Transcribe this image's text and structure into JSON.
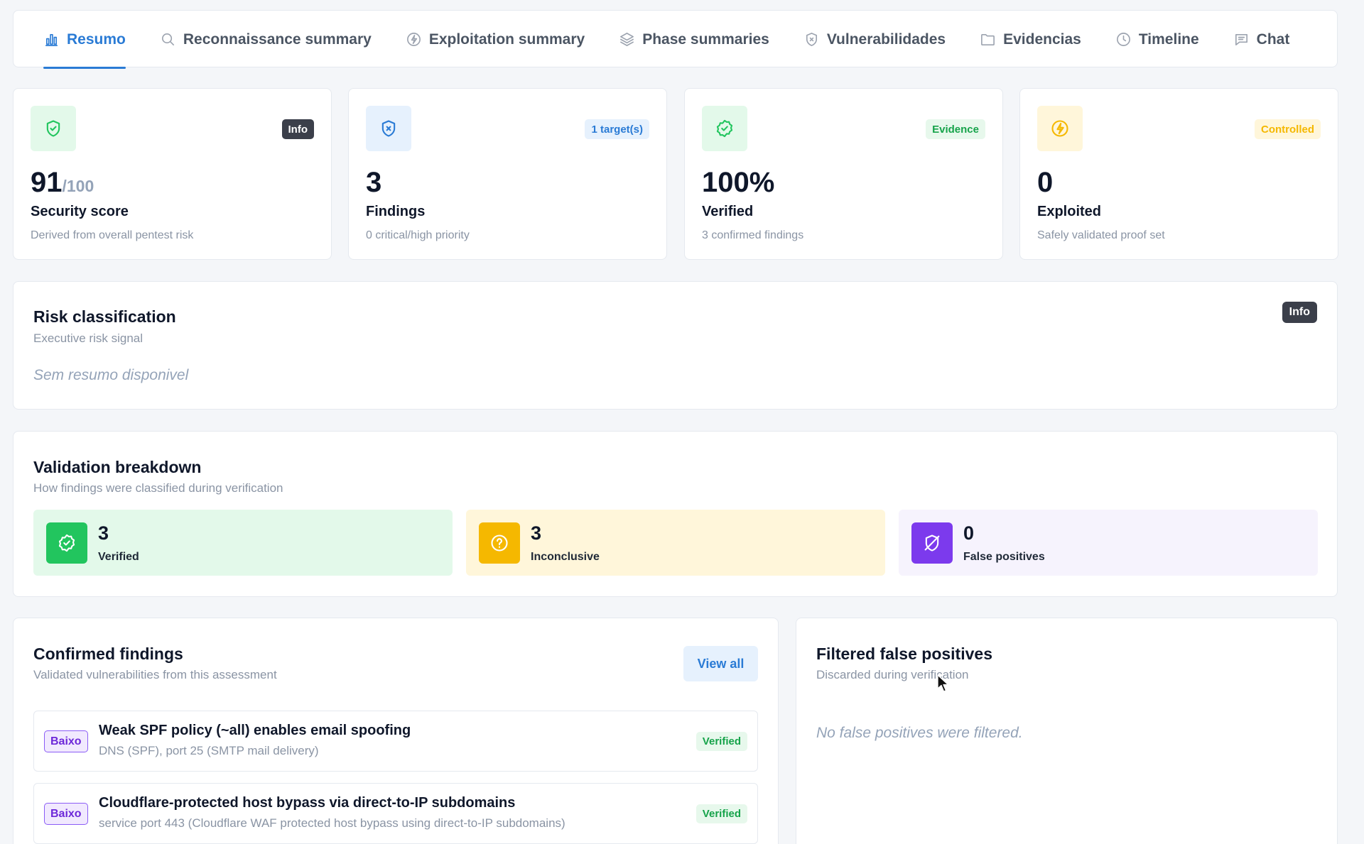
{
  "tabs": [
    {
      "label": "Resumo",
      "icon": "bar-chart-icon",
      "active": true
    },
    {
      "label": "Reconnaissance summary",
      "icon": "search-icon",
      "active": false
    },
    {
      "label": "Exploitation summary",
      "icon": "bolt-circle-icon",
      "active": false
    },
    {
      "label": "Phase summaries",
      "icon": "layers-icon",
      "active": false
    },
    {
      "label": "Vulnerabilidades",
      "icon": "shield-x-icon",
      "active": false
    },
    {
      "label": "Evidencias",
      "icon": "folder-icon",
      "active": false
    },
    {
      "label": "Timeline",
      "icon": "clock-icon",
      "active": false
    },
    {
      "label": "Chat",
      "icon": "chat-icon",
      "active": false
    }
  ],
  "stats": [
    {
      "value": "91",
      "suffix": "/100",
      "label": "Security score",
      "sub": "Derived from overall pentest risk",
      "badge": "Info",
      "icon": "shield-check-icon"
    },
    {
      "value": "3",
      "label": "Findings",
      "sub": "0 critical/high priority",
      "badge": "1 target(s)",
      "icon": "shield-x-icon"
    },
    {
      "value": "100%",
      "label": "Verified",
      "sub": "3 confirmed findings",
      "badge": "Evidence",
      "icon": "badge-check-icon"
    },
    {
      "value": "0",
      "label": "Exploited",
      "sub": "Safely validated proof set",
      "badge": "Controlled",
      "icon": "bolt-circle-icon"
    }
  ],
  "risk": {
    "title": "Risk classification",
    "subtitle": "Executive risk signal",
    "badge": "Info",
    "empty": "Sem resumo disponivel"
  },
  "validation": {
    "title": "Validation breakdown",
    "subtitle": "How findings were classified during verification",
    "items": [
      {
        "value": "3",
        "label": "Verified",
        "icon": "badge-check-icon",
        "color": "#22c55e",
        "bg": "#e3f9ea"
      },
      {
        "value": "3",
        "label": "Inconclusive",
        "icon": "help-circle-icon",
        "color": "#f5b800",
        "bg": "#fff6da"
      },
      {
        "value": "0",
        "label": "False positives",
        "icon": "shield-off-icon",
        "color": "#7c3aed",
        "bg": "#f6f3fd"
      }
    ]
  },
  "findings": {
    "title": "Confirmed findings",
    "subtitle": "Validated vulnerabilities from this assessment",
    "view_all": "View all",
    "items": [
      {
        "severity": "Baixo",
        "title": "Weak SPF policy (~all) enables email spoofing",
        "sub": "DNS (SPF), port 25 (SMTP mail delivery)",
        "status": "Verified"
      },
      {
        "severity": "Baixo",
        "title": "Cloudflare-protected host bypass via direct-to-IP subdomains",
        "sub": "service port 443 (Cloudflare WAF protected host bypass using direct-to-IP subdomains)",
        "status": "Verified"
      }
    ]
  },
  "false_positives": {
    "title": "Filtered false positives",
    "subtitle": "Discarded during verification",
    "empty": "No false positives were filtered."
  }
}
